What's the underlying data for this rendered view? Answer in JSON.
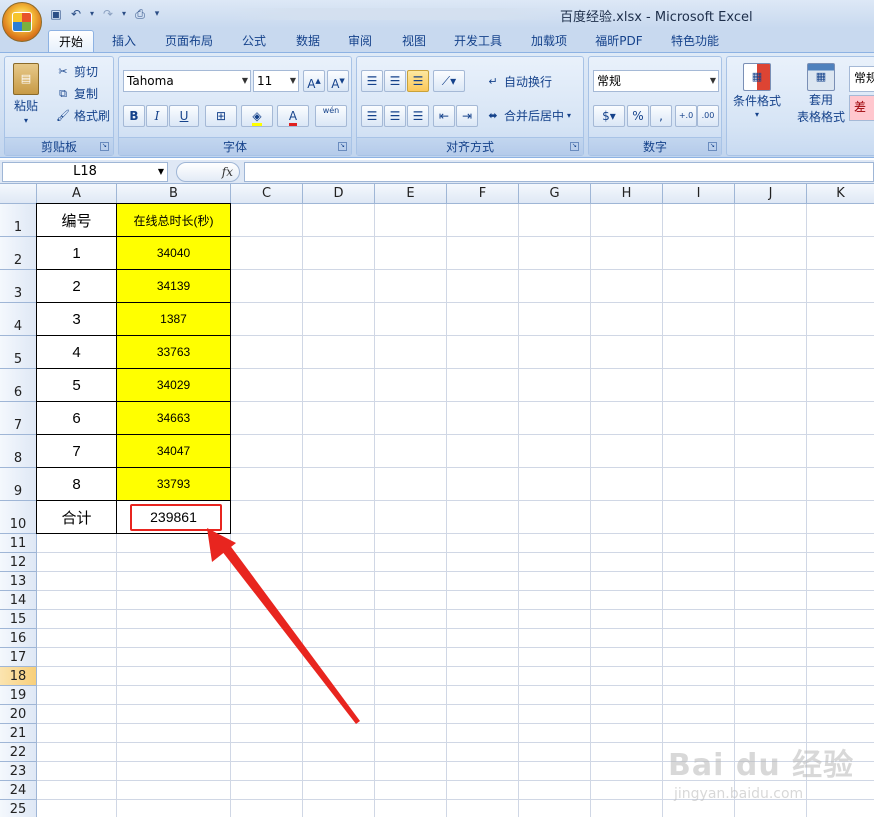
{
  "title": "百度经验.xlsx - Microsoft Excel",
  "tabs": [
    "开始",
    "插入",
    "页面布局",
    "公式",
    "数据",
    "审阅",
    "视图",
    "开发工具",
    "加载项",
    "福昕PDF",
    "特色功能"
  ],
  "ribbon": {
    "clipboard": {
      "paste": "粘贴",
      "cut": "剪切",
      "copy": "复制",
      "format_painter": "格式刷",
      "label": "剪贴板"
    },
    "font": {
      "name": "Tahoma",
      "size": "11",
      "label": "字体",
      "bold": "B",
      "italic": "I",
      "underline": "U",
      "font_color": "A",
      "phonetic": "wén"
    },
    "alignment": {
      "wrap": "自动换行",
      "merge": "合并后居中",
      "label": "对齐方式"
    },
    "number": {
      "format": "常规",
      "percent": "%",
      "comma": ",",
      "label": "数字"
    },
    "styles": {
      "conditional": "条件格式",
      "table_format_1": "套用",
      "table_format_2": "表格格式",
      "normal": "常规",
      "bad": "差"
    }
  },
  "formula_bar": {
    "name_box": "L18",
    "fx": "fx",
    "content": ""
  },
  "columns": [
    "A",
    "B",
    "C",
    "D",
    "E",
    "F",
    "G",
    "H",
    "I",
    "J",
    "K"
  ],
  "rows": [
    "1",
    "2",
    "3",
    "4",
    "5",
    "6",
    "7",
    "8",
    "9",
    "10",
    "11",
    "12",
    "13",
    "14",
    "15",
    "16",
    "17",
    "18",
    "19",
    "20",
    "21",
    "22",
    "23",
    "24",
    "25"
  ],
  "selected_row": "18",
  "sheet": {
    "header_a": "编号",
    "header_b": "在线总时长(秒)",
    "data": [
      {
        "id": "1",
        "value": "34040"
      },
      {
        "id": "2",
        "value": "34139"
      },
      {
        "id": "3",
        "value": "1387"
      },
      {
        "id": "4",
        "value": "33763"
      },
      {
        "id": "5",
        "value": "34029"
      },
      {
        "id": "6",
        "value": "34663"
      },
      {
        "id": "7",
        "value": "34047"
      },
      {
        "id": "8",
        "value": "33793"
      }
    ],
    "total_label": "合计",
    "total_value": "239861"
  },
  "colors": {
    "highlight": "#ffff00",
    "annotation": "#e8251f",
    "ribbon_text": "#15428b"
  },
  "watermark": {
    "brand": "Bai du 经验",
    "url": "jingyan.baidu.com"
  }
}
